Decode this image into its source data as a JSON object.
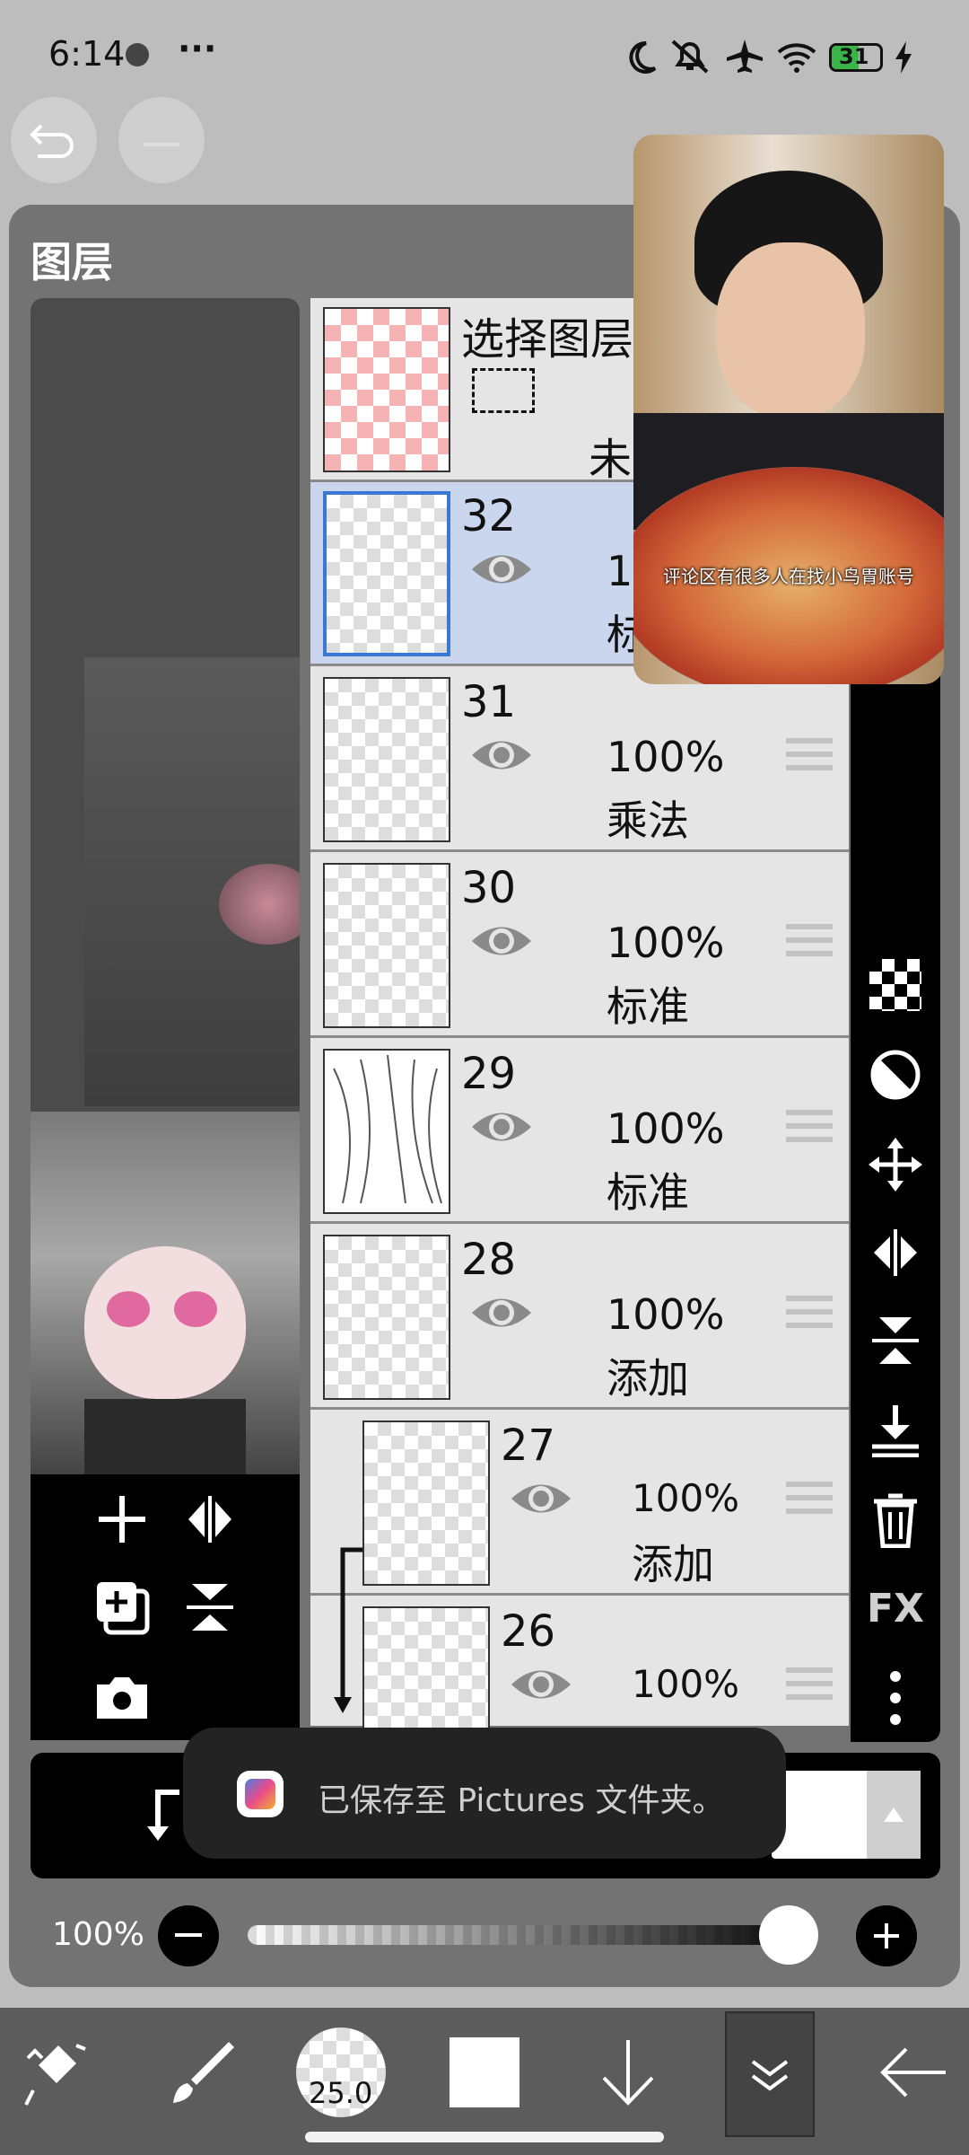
{
  "status_bar": {
    "time": "6:14",
    "more": "···",
    "battery": "31"
  },
  "layers_panel": {
    "title": "图层"
  },
  "selection_layer": {
    "label": "选择图层",
    "status": "未"
  },
  "layers": [
    {
      "number": "32",
      "opacity": "10",
      "mode": "标",
      "selected": true
    },
    {
      "number": "31",
      "opacity": "100%",
      "mode": "乘法"
    },
    {
      "number": "30",
      "opacity": "100%",
      "mode": "标准"
    },
    {
      "number": "29",
      "opacity": "100%",
      "mode": "标准"
    },
    {
      "number": "28",
      "opacity": "100%",
      "mode": "添加"
    },
    {
      "number": "27",
      "opacity": "100%",
      "mode": "添加",
      "clipped": true
    },
    {
      "number": "26",
      "opacity": "100%",
      "mode": "",
      "clipped": true
    }
  ],
  "right_toolbar": {
    "fx_label": "FX"
  },
  "video_overlay": {
    "caption": "评论区有很多人在找小鸟胃账号"
  },
  "toast": {
    "message": "已保存至 Pictures 文件夹。"
  },
  "opacity_slider": {
    "label": "100%",
    "value": 1.0
  },
  "bottom_toolbar": {
    "brush_size": "25.0"
  },
  "colors": {
    "panel_bg": "#737373",
    "selected_row": "#c9d6ee",
    "row_bg": "#e5e5e5",
    "accent_border": "#3a78d6"
  }
}
